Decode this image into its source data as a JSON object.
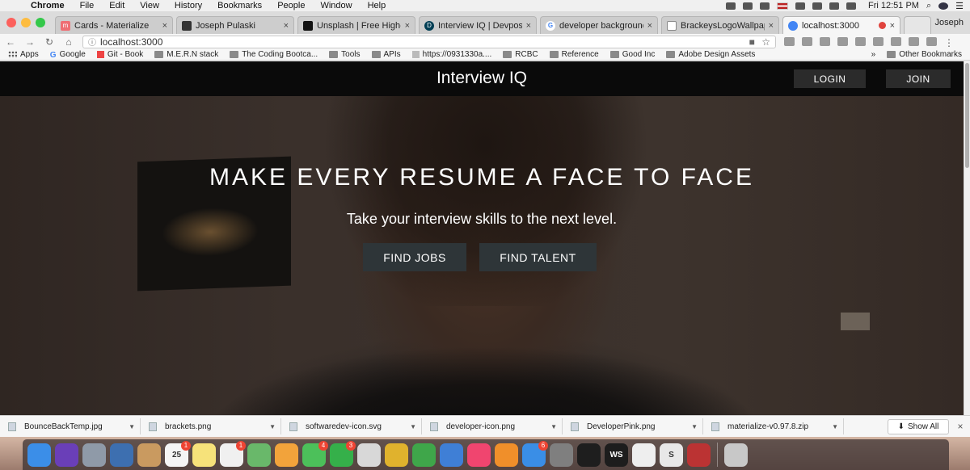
{
  "menubar": {
    "app": "Chrome",
    "items": [
      "File",
      "Edit",
      "View",
      "History",
      "Bookmarks",
      "People",
      "Window",
      "Help"
    ],
    "clock": "Fri 12:51 PM"
  },
  "tabs": [
    {
      "title": "Cards - Materialize",
      "favicon": "materialize-icon",
      "color": "#ee6e73"
    },
    {
      "title": "Joseph Pulaski",
      "favicon": "profile-icon",
      "color": "#333333"
    },
    {
      "title": "Unsplash | Free High-Resolution",
      "favicon": "camera-icon",
      "color": "#111111"
    },
    {
      "title": "Interview IQ | Devpost",
      "favicon": "devpost-icon",
      "color": "#003e54"
    },
    {
      "title": "developer background",
      "favicon": "google-icon",
      "color": "#4285f4"
    },
    {
      "title": "BrackeysLogoWallpaper",
      "favicon": "page-icon",
      "color": "#888888"
    },
    {
      "title": "localhost:3000",
      "favicon": "globe-icon",
      "color": "#4285f4"
    }
  ],
  "profile_name": "Joseph",
  "address": {
    "url": "localhost:3000"
  },
  "bookmarks": [
    {
      "label": "Apps",
      "icon": "apps"
    },
    {
      "label": "Google",
      "icon": "g"
    },
    {
      "label": "Git - Book",
      "icon": "doc"
    },
    {
      "label": "M.E.R.N stack",
      "icon": "folder"
    },
    {
      "label": "The Coding Bootca...",
      "icon": "folder"
    },
    {
      "label": "Tools",
      "icon": "folder"
    },
    {
      "label": "APIs",
      "icon": "folder"
    },
    {
      "label": "https://0931330a....",
      "icon": "doc"
    },
    {
      "label": "RCBC",
      "icon": "folder"
    },
    {
      "label": "Reference",
      "icon": "folder"
    },
    {
      "label": "Good Inc",
      "icon": "folder"
    },
    {
      "label": "Adobe Design Assets",
      "icon": "folder"
    }
  ],
  "bookmarks_more": "»",
  "other_bookmarks": "Other Bookmarks",
  "site": {
    "brand": "Interview IQ",
    "login": "LOGIN",
    "join": "JOIN",
    "headline": "MAKE EVERY RESUME A FACE TO FACE",
    "subline": "Take your interview skills to the next level.",
    "cta_jobs": "FIND JOBS",
    "cta_talent": "FIND TALENT"
  },
  "downloads": [
    "BounceBackTemp.jpg",
    "brackets.png",
    "softwaredev-icon.svg",
    "developer-icon.png",
    "DeveloperPink.png",
    "materialize-v0.97.8.zip"
  ],
  "show_all": "Show All",
  "dock": [
    {
      "name": "finder-icon",
      "color": "#3b8ee8"
    },
    {
      "name": "siri-icon",
      "color": "#6a3fb8"
    },
    {
      "name": "launchpad-icon",
      "color": "#8f9aa8"
    },
    {
      "name": "preview-icon",
      "color": "#3d6fb0"
    },
    {
      "name": "contacts-icon",
      "color": "#c99a60"
    },
    {
      "name": "calendar-icon",
      "color": "#f5f5f5",
      "label": "25",
      "badge": "1"
    },
    {
      "name": "notes-icon",
      "color": "#f6e27a"
    },
    {
      "name": "reminders-icon",
      "color": "#f0f0f0",
      "badge": "1"
    },
    {
      "name": "maps-icon",
      "color": "#69b86a"
    },
    {
      "name": "photos-icon",
      "color": "#f2a33b"
    },
    {
      "name": "messages-icon",
      "color": "#4cc05a",
      "badge": "4"
    },
    {
      "name": "facetime-icon",
      "color": "#35b04a",
      "badge": "3"
    },
    {
      "name": "script-editor-icon",
      "color": "#d8d8d8"
    },
    {
      "name": "chrome-icon",
      "color": "#e0b22d"
    },
    {
      "name": "numbers-icon",
      "color": "#3fa64a"
    },
    {
      "name": "keynote-icon",
      "color": "#3f7fd6"
    },
    {
      "name": "itunes-icon",
      "color": "#f0456f"
    },
    {
      "name": "ibooks-icon",
      "color": "#f08f2a"
    },
    {
      "name": "app-store-icon",
      "color": "#3a8ee6",
      "badge": "6"
    },
    {
      "name": "system-preferences-icon",
      "color": "#7f7f7f"
    },
    {
      "name": "terminal-icon",
      "color": "#1e1e1e"
    },
    {
      "name": "webstorm-icon",
      "color": "#1d1d1d",
      "label": "WS"
    },
    {
      "name": "textedit-icon",
      "color": "#eeeeee"
    },
    {
      "name": "slack-icon",
      "color": "#e8e8e8",
      "label": "S"
    },
    {
      "name": "photo-booth-icon",
      "color": "#b33"
    },
    {
      "name": "trash-icon",
      "color": "#c8c8c8"
    }
  ]
}
